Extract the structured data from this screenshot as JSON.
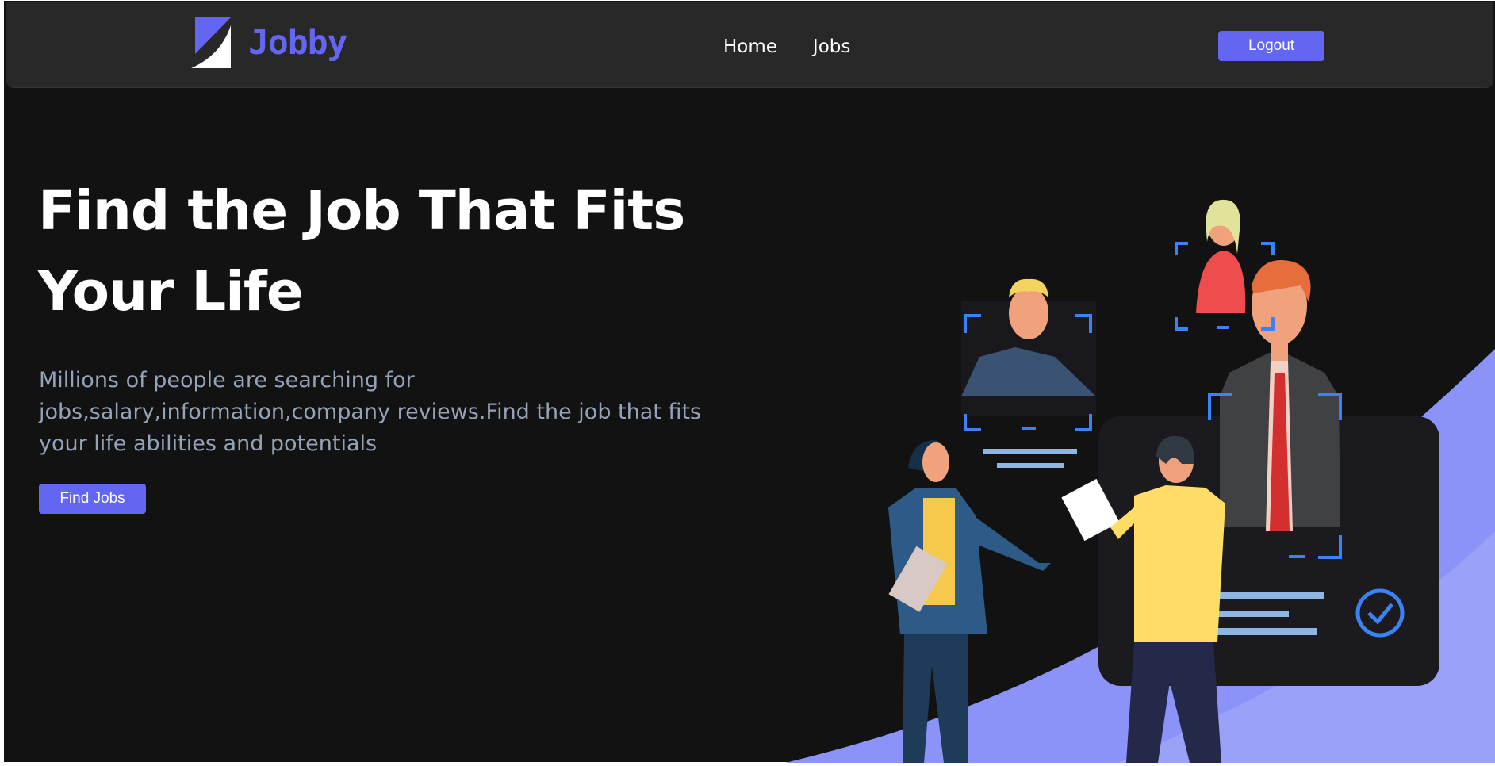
{
  "colors": {
    "accent": "#6366f1",
    "background": "#121212",
    "navbar": "#282828",
    "muted_text": "#94a3b8",
    "wave": "#8b92f8"
  },
  "header": {
    "brand": "Jobby",
    "nav": [
      {
        "label": "Home"
      },
      {
        "label": "Jobs"
      }
    ],
    "logout_label": "Logout"
  },
  "hero": {
    "title_line1": "Find the Job That Fits",
    "title_line2": "Your Life",
    "description": "Millions of people are searching for jobs,salary,information,company reviews.Find the job that fits your life abilities and potentials",
    "cta_label": "Find Jobs"
  },
  "illustration": {
    "icons": [
      "logo-icon",
      "check-circle-icon"
    ]
  }
}
